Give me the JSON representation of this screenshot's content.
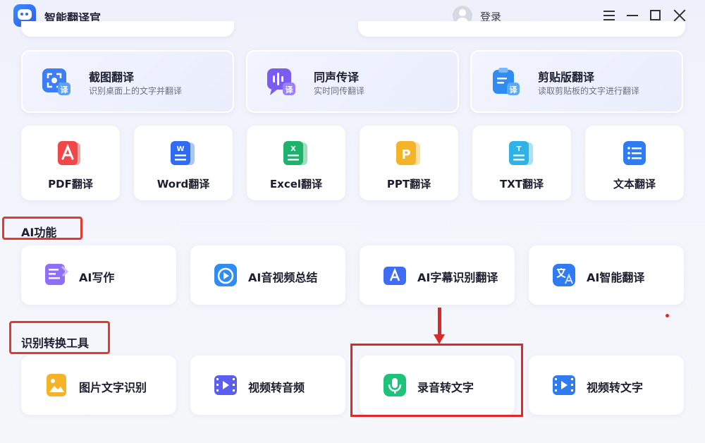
{
  "app": {
    "title": "智能翻译官",
    "login_label": "登录"
  },
  "feature_cards": [
    {
      "title": "截图翻译",
      "subtitle": "识别桌面上的文字并翻译",
      "icon": "screenshot-translate-icon"
    },
    {
      "title": "同声传译",
      "subtitle": "实时同传翻译",
      "icon": "simultaneous-interpretation-icon"
    },
    {
      "title": "剪贴版翻译",
      "subtitle": "读取剪贴板的文字进行翻译",
      "icon": "clipboard-translate-icon"
    }
  ],
  "feature_badge": "译",
  "doc_cards": [
    {
      "label": "PDF翻译",
      "icon": "pdf-icon",
      "color": "#f04848",
      "glyph": "⅄"
    },
    {
      "label": "Word翻译",
      "icon": "word-icon",
      "color": "#2f6cf2",
      "glyph": "W"
    },
    {
      "label": "Excel翻译",
      "icon": "excel-icon",
      "color": "#1fb26a",
      "glyph": "X"
    },
    {
      "label": "PPT翻译",
      "icon": "ppt-icon",
      "color": "#f5b428",
      "glyph": "P"
    },
    {
      "label": "TXT翻译",
      "icon": "txt-icon",
      "color": "#2fb3e6",
      "glyph": "T"
    },
    {
      "label": "文本翻译",
      "icon": "text-icon",
      "color": "#2f7cf2",
      "glyph": ""
    }
  ],
  "sections": {
    "ai": "AI功能",
    "tools": "识别转换工具"
  },
  "ai_cards": [
    {
      "label": "AI写作",
      "icon": "ai-writing-icon",
      "color": "#7f5cf2"
    },
    {
      "label": "AI音视频总结",
      "icon": "ai-av-summary-icon",
      "color": "#2f8cf2"
    },
    {
      "label": "AI字幕识别翻译",
      "icon": "ai-subtitle-icon",
      "color": "#3f6cf2"
    },
    {
      "label": "AI智能翻译",
      "icon": "ai-translate-icon",
      "color": "#2f7cf2"
    }
  ],
  "tool_cards": [
    {
      "label": "图片文字识别",
      "icon": "image-ocr-icon",
      "color": "#f5b428"
    },
    {
      "label": "视频转音频",
      "icon": "video-to-audio-icon",
      "color": "#5b5ef2"
    },
    {
      "label": "录音转文字",
      "icon": "record-to-text-icon",
      "color": "#1fc27a"
    },
    {
      "label": "视频转文字",
      "icon": "video-to-text-icon",
      "color": "#2f7cf2"
    }
  ],
  "colors": {
    "annotation_red": "#e0282a",
    "accent_blue": "#2f6cf2"
  }
}
